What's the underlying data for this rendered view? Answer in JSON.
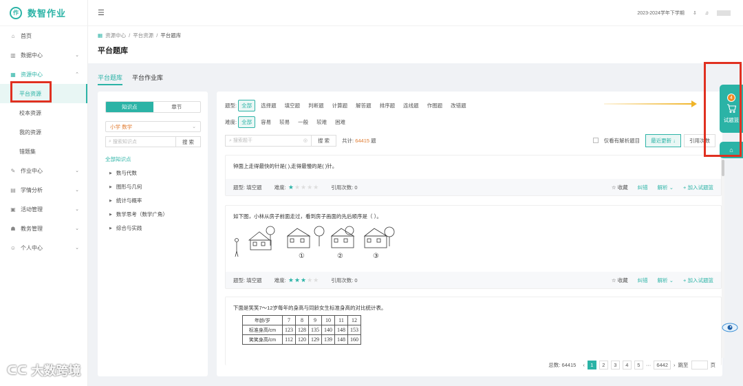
{
  "app": {
    "logo_text": "数智作业",
    "logo_glyph": "作"
  },
  "sidebar": {
    "items": [
      {
        "label": "首页",
        "icon": "⌂"
      },
      {
        "label": "数据中心",
        "icon": "▥",
        "caret": "⌄"
      },
      {
        "label": "资源中心",
        "icon": "▦",
        "caret": "⌃"
      },
      {
        "label": "作业中心",
        "icon": "✎",
        "caret": "⌄"
      },
      {
        "label": "学情分析",
        "icon": "▤",
        "caret": "⌄"
      },
      {
        "label": "活动管理",
        "icon": "▣",
        "caret": "⌄"
      },
      {
        "label": "教务管理",
        "icon": "☗",
        "caret": "⌄"
      },
      {
        "label": "个人中心",
        "icon": "☺",
        "caret": "⌄"
      }
    ],
    "subitems": [
      {
        "label": "平台资源"
      },
      {
        "label": "校本资源"
      },
      {
        "label": "我的资源"
      },
      {
        "label": "错题集"
      }
    ]
  },
  "header": {
    "collapse_icon": "☰",
    "term": "2023-2024学年下学期",
    "download_icon": "⇩",
    "bell_icon": "♫"
  },
  "breadcrumb": {
    "items": [
      "资源中心",
      "平台资源",
      "平台题库"
    ],
    "sep": "/"
  },
  "page_title": "平台题库",
  "main_tabs": [
    {
      "label": "平台题库"
    },
    {
      "label": "平台作业库"
    }
  ],
  "tree": {
    "seg": [
      "知识点",
      "章节"
    ],
    "grade_select": "小学 数学",
    "search_placeholder": "搜索知识点",
    "search_btn": "搜 索",
    "all_label": "全部知识点",
    "nodes": [
      "数与代数",
      "图形与几何",
      "统计与概率",
      "数学思考（数学广角）",
      "综合与实践"
    ]
  },
  "filters": {
    "type_label": "题型:",
    "types": [
      "全部",
      "选择题",
      "填空题",
      "判断题",
      "计算题",
      "解答题",
      "排序题",
      "连线题",
      "作图题",
      "改错题"
    ],
    "diff_label": "难度:",
    "diffs": [
      "全部",
      "容易",
      "较易",
      "一般",
      "较难",
      "困难"
    ]
  },
  "search": {
    "placeholder": "搜索题干",
    "camera_icon": "◎",
    "btn": "搜 索",
    "total_prefix": "共计:",
    "total": "64415",
    "total_suffix": "题",
    "only_analysis": "仅看有解析题目",
    "sort_recent": "最近更新 ↓",
    "sort_cite": "引用次数"
  },
  "questions": [
    {
      "text": "钟面上走得最快的针是(        ),走得最慢的是(        )针。",
      "type_label": "题型: 填空题",
      "diff_label": "难度:",
      "stars": 1,
      "cite": "引用次数: 0"
    },
    {
      "text": "如下图，小林从房子前面走过，看到房子画面的先后顺序是（     ）。",
      "type_label": "题型: 填空题",
      "diff_label": "难度:",
      "stars": 3,
      "cite": "引用次数: 0",
      "circle_labels": [
        "①",
        "②",
        "③"
      ]
    },
    {
      "text": "下面是笑笑7～12岁每年的身高与同龄女生标准身高的对比统计表。",
      "table": {
        "header": [
          "年龄/岁",
          "7",
          "8",
          "9",
          "10",
          "11",
          "12"
        ],
        "row1": [
          "标准身高/cm",
          "123",
          "128",
          "135",
          "140",
          "148",
          "153"
        ],
        "row2": [
          "笑笑身高/cm",
          "112",
          "120",
          "129",
          "139",
          "148",
          "160"
        ]
      }
    }
  ],
  "q_actions": {
    "collect": "☆ 收藏",
    "correct": "纠错",
    "analysis": "解析 ⌄",
    "add": "+ 加入试题篮"
  },
  "pager": {
    "total_label": "总数: 64415",
    "pages": [
      "1",
      "2",
      "3",
      "4",
      "5"
    ],
    "ellipsis": "···",
    "last": "6442",
    "jump": "跳至",
    "page_unit": "页",
    "prev": "‹",
    "next": "›"
  },
  "cart": {
    "count": "4",
    "label": "试题篮",
    "icon": "🛒",
    "home_icon": "⌂"
  },
  "watermark": {
    "text": "大数跨境",
    "mark": "ᑕᑕ"
  },
  "colors": {
    "accent": "#2bb3a6",
    "highlight": "#e03020",
    "arrow": "#f0b428",
    "number": "#e07a2e"
  }
}
